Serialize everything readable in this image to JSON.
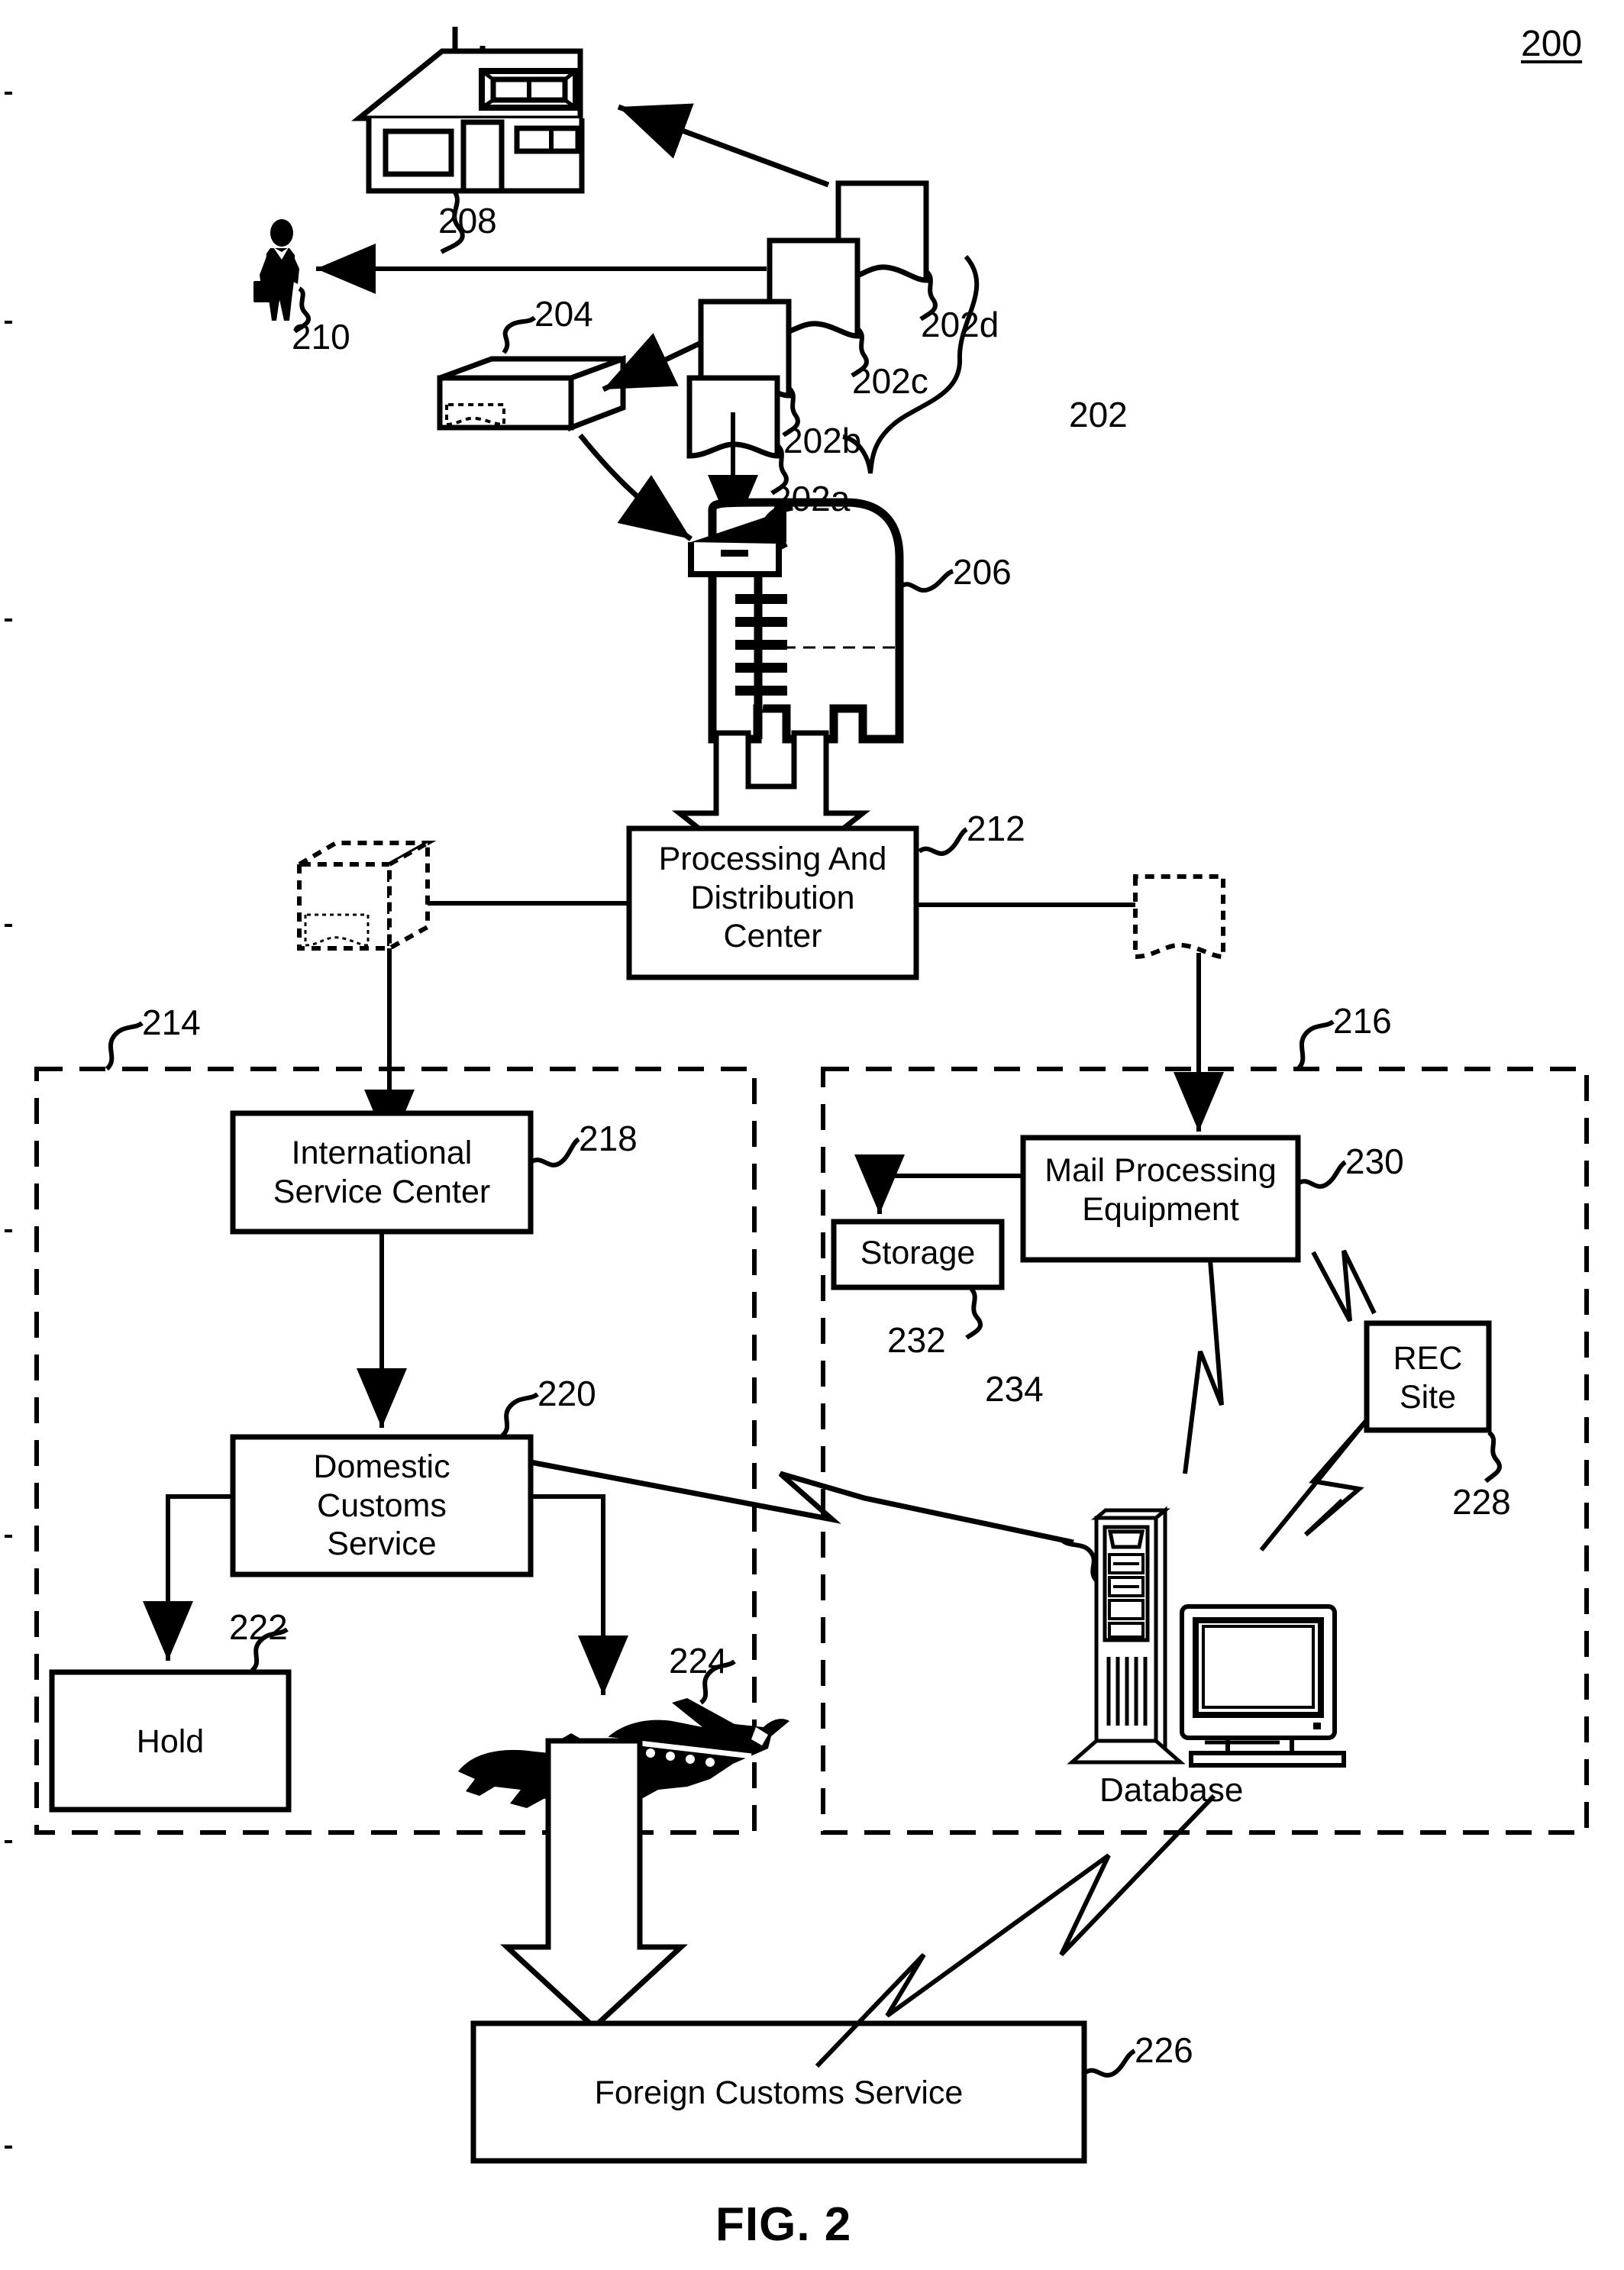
{
  "figure": {
    "number_label": "200",
    "caption": "FIG. 2"
  },
  "reference_numerals": {
    "system": "200",
    "mail_pieces_group": "202",
    "mail_piece_a": "202a",
    "mail_piece_b": "202b",
    "mail_piece_c": "202c",
    "mail_piece_d": "202d",
    "package": "204",
    "collection_box": "206",
    "residence": "208",
    "person": "210",
    "processing_center": "212",
    "international_zone": "214",
    "domestic_zone": "216",
    "international_service_center": "218",
    "domestic_customs_service": "220",
    "hold": "222",
    "aircraft": "224",
    "foreign_customs_service": "226",
    "rec_site": "228",
    "mail_processing_equipment": "230",
    "storage": "232",
    "database_computer": "234"
  },
  "boxes": {
    "processing_center": {
      "label": "Processing And Distribution Center",
      "lines": [
        "Processing And",
        "Distribution",
        "Center"
      ],
      "ref": "212"
    },
    "international_service_center": {
      "label": "International Service Center",
      "lines": [
        "International",
        "Service Center"
      ],
      "ref": "218"
    },
    "domestic_customs_service": {
      "label": "Domestic Customs Service",
      "lines": [
        "Domestic",
        "Customs",
        "Service"
      ],
      "ref": "220"
    },
    "hold": {
      "label": "Hold",
      "lines": [
        "Hold"
      ],
      "ref": "222"
    },
    "foreign_customs_service": {
      "label": "Foreign Customs Service",
      "lines": [
        "Foreign Customs Service"
      ],
      "ref": "226"
    },
    "mail_processing_equipment": {
      "label": "Mail Processing Equipment",
      "lines": [
        "Mail Processing",
        "Equipment"
      ],
      "ref": "230"
    },
    "storage": {
      "label": "Storage",
      "lines": [
        "Storage"
      ],
      "ref": "232"
    },
    "rec_site": {
      "label": "REC Site",
      "lines": [
        "REC",
        "Site"
      ],
      "ref": "228"
    }
  },
  "captions": {
    "database": "Database"
  },
  "icons": {
    "house": "house-icon",
    "person": "person-icon",
    "package": "package-icon",
    "mailbox": "mailbox-icon",
    "envelope": "envelope-icon",
    "airplane": "airplane-icon",
    "computer": "computer-icon",
    "server_tower": "server-tower-icon",
    "dashed_package": "dashed-package-icon",
    "dashed_envelope": "dashed-envelope-icon"
  },
  "colors": {
    "ink": "#000000",
    "background": "#ffffff"
  }
}
